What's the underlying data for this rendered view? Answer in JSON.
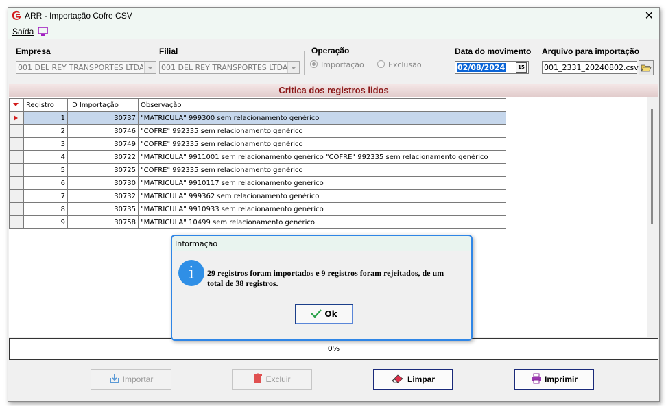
{
  "window": {
    "title": "ARR -  Importação Cofre CSV",
    "icon": "app-logo-icon",
    "close_glyph": "✕"
  },
  "menu": {
    "saida": "Saída",
    "monitor_icon": "monitor-icon"
  },
  "filters": {
    "empresa_label": "Empresa",
    "empresa_value": "001 DEL REY TRANSPORTES LTDA",
    "filial_label": "Filial",
    "filial_value": "001 DEL REY TRANSPORTES LTDA",
    "operacao_label": "Operação",
    "operacao_options": [
      "Importação",
      "Exclusão"
    ],
    "operacao_selected": "Importação",
    "data_label": "Data do movimento",
    "data_value": "02/08/2024",
    "arquivo_label": "Arquivo para importação",
    "arquivo_value": "001_2331_20240802.csv"
  },
  "section_title": "Critica dos registros lidos",
  "grid": {
    "columns": [
      "Registro",
      "ID Importação",
      "Observação"
    ],
    "rows": [
      {
        "registro": "1",
        "id": "30737",
        "obs": "\"MATRICULA\" 999300 sem relacionamento genérico"
      },
      {
        "registro": "2",
        "id": "30746",
        "obs": "\"COFRE\" 992335 sem relacionamento genérico"
      },
      {
        "registro": "3",
        "id": "30749",
        "obs": "\"COFRE\" 992335 sem relacionamento genérico"
      },
      {
        "registro": "4",
        "id": "30722",
        "obs": "\"MATRICULA\" 9911001 sem relacionamento genérico \"COFRE\" 992335 sem relacionamento genérico"
      },
      {
        "registro": "5",
        "id": "30725",
        "obs": "\"COFRE\" 992335 sem relacionamento genérico"
      },
      {
        "registro": "6",
        "id": "30730",
        "obs": "\"MATRICULA\" 9910117 sem relacionamento genérico"
      },
      {
        "registro": "7",
        "id": "30732",
        "obs": "\"MATRICULA\" 999362 sem relacionamento genérico"
      },
      {
        "registro": "8",
        "id": "30735",
        "obs": "\"MATRICULA\" 9910933 sem relacionamento genérico"
      },
      {
        "registro": "9",
        "id": "30758",
        "obs": "\"MATRICULA\" 10499 sem relacionamento genérico"
      }
    ],
    "selected_row": 0
  },
  "progress": {
    "text": "0%",
    "value": 0
  },
  "buttons": {
    "importar": "Importar",
    "excluir": "Excluir",
    "limpar": "Limpar",
    "imprimir": "Imprimir"
  },
  "dialog": {
    "title": "Informação",
    "icon": "info-icon",
    "message_line1": "29 registros foram importados e 9 registros foram rejeitados, de um",
    "message_line2": "total de 38 registros.",
    "ok_label": "Ok"
  },
  "colors": {
    "accent_blue": "#0a64d6",
    "section_title_red": "#8b1818",
    "indicator_red": "#d21b1b",
    "dialog_border": "#2f86e6"
  }
}
